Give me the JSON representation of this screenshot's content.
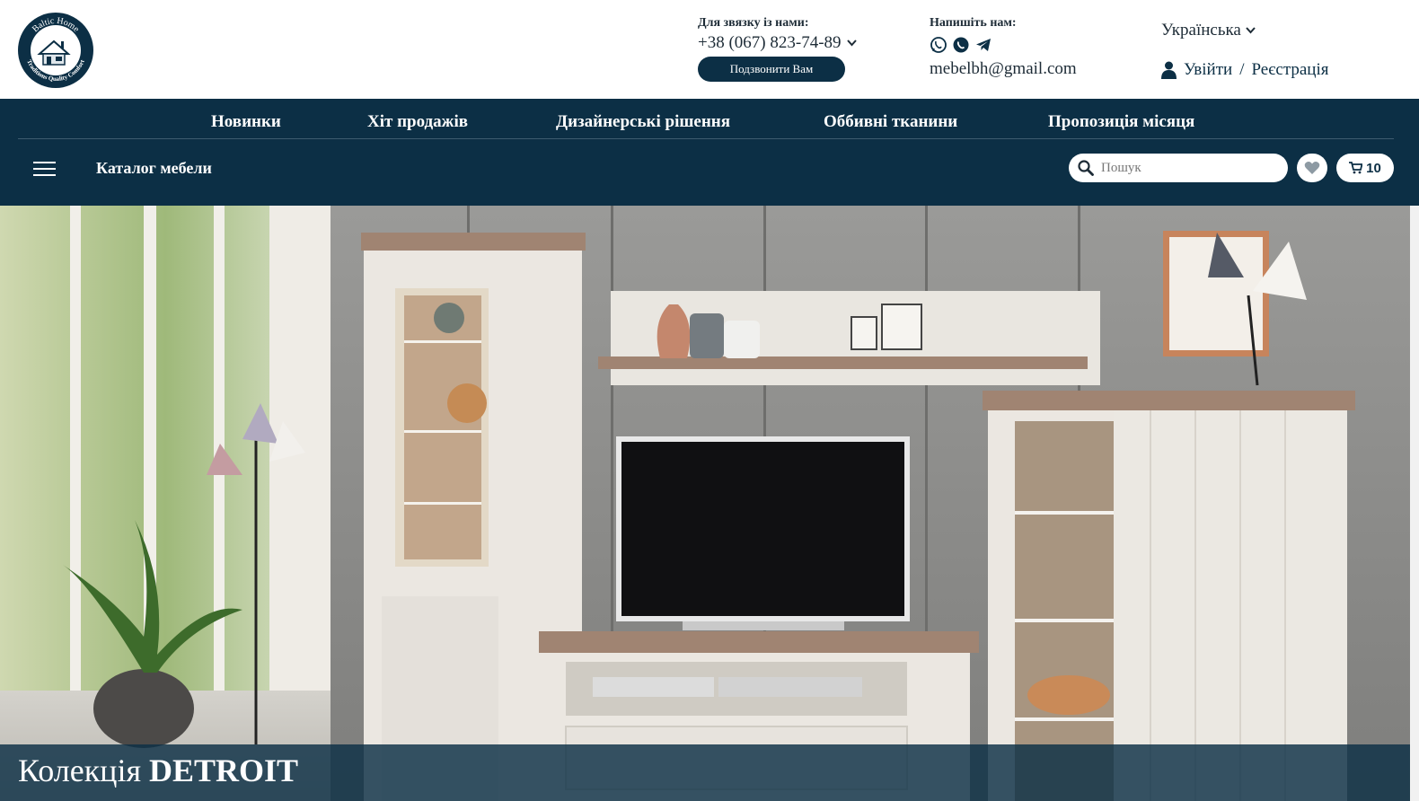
{
  "header": {
    "logo": {
      "icon": "baltic-home-logo",
      "text_top": "Baltic Home",
      "text_bottom": "Traditions Quality Comfort"
    },
    "contact": {
      "label": "Для звязку із нами:",
      "phone": "+38 (067) 823-74-89",
      "callback_button": "Подзвонити Вам"
    },
    "write": {
      "label": "Напишіть нам:",
      "messengers": [
        "viber-icon",
        "whatsapp-icon",
        "telegram-icon"
      ],
      "email": "mebelbh@gmail.com"
    },
    "language": "Українська",
    "account": {
      "login": "Увійти",
      "separator": "/",
      "register": "Реєстрація"
    }
  },
  "nav": {
    "top_menu": [
      "Новинки",
      "Хіт продажів",
      "Дизайнерські рішення",
      "Оббивні тканини",
      "Пропозиція місяця"
    ],
    "catalog_label": "Каталог мебели",
    "search_placeholder": "Пошук",
    "cart_count": "10"
  },
  "hero": {
    "caption_prefix": "Колекція",
    "caption_name": "DETROIT"
  },
  "colors": {
    "primary": "#0c2f45",
    "white": "#ffffff"
  }
}
